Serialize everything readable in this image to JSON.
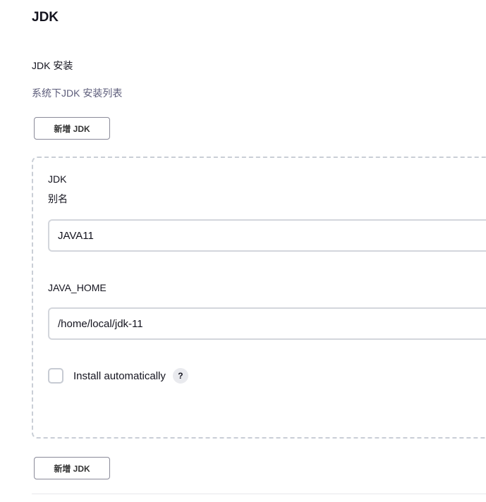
{
  "section": {
    "title": "JDK"
  },
  "jdk_installations": {
    "label": "JDK 安装",
    "description": "系统下JDK 安装列表",
    "add_button_label": "新增 JDK"
  },
  "jdk_card": {
    "name": "JDK",
    "alias_label": "别名",
    "alias_value": "JAVA11",
    "java_home_label": "JAVA_HOME",
    "java_home_value": "/home/local/jdk-11",
    "install_automatically_label": "Install automatically",
    "install_automatically_checked": false,
    "help_icon_text": "?"
  },
  "colors": {
    "description_text": "#5c5c7a",
    "dashed_border": "#c9ced6",
    "button_border": "#8a8a99"
  }
}
